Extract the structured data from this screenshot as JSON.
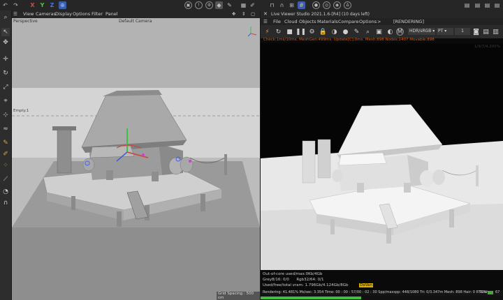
{
  "top_toolbar": {
    "axes": [
      "X",
      "Y",
      "Z"
    ],
    "axis_colors": {
      "x": "#d04a4a",
      "y": "#5bbf4e",
      "z": "#4a74d8"
    }
  },
  "viewport_menu": [
    "View",
    "Cameras",
    "Display",
    "Options",
    "Filter",
    "Panel"
  ],
  "viewport": {
    "name": "Perspective",
    "camera": "Default Camera",
    "object_tag": "Empty.1",
    "grid_spacing": "Grid Spacing : 500 cm"
  },
  "live_viewer": {
    "title": "Live Viewer Studio 2021.1.6-[R4] (10 days left)",
    "menu": [
      "File",
      "Cloud",
      "Objects",
      "Materials",
      "Compare",
      "Options",
      ">"
    ],
    "status_tag": "[RENDERING]",
    "color_space": "HDR/sRGB",
    "kernel": "PT",
    "count": "1",
    "stats_line": "Check:1ms/10ms. MeshGen:499ms. Update[C]:0ms. Mesh:898 Nodes:1407 Movable:898",
    "watermark": "1/9/7/4.200%"
  },
  "bottom_info": {
    "line1": "Out-of-core used/max:0Kb/4Gb",
    "line2a": "Grey8/16: 0/0",
    "line2b": "Rgb32/64: 0/1",
    "line3": "Used/free/total vram: 1.796Gb/4.124Gb/8Gb",
    "line3_tag": "DeVan",
    "status": "Rendering: 41.481%  Ms/sec: 3.354  Time: 00 : 00 : 57/00 : 02 : 30  Spp/maxspp: 448/1080  Tri: 0/3.347m  Mesh: 898  Hair: 0  RTX:on",
    "gpu": "GPU",
    "gpu_value": "67"
  },
  "progress_percent": 41.481
}
